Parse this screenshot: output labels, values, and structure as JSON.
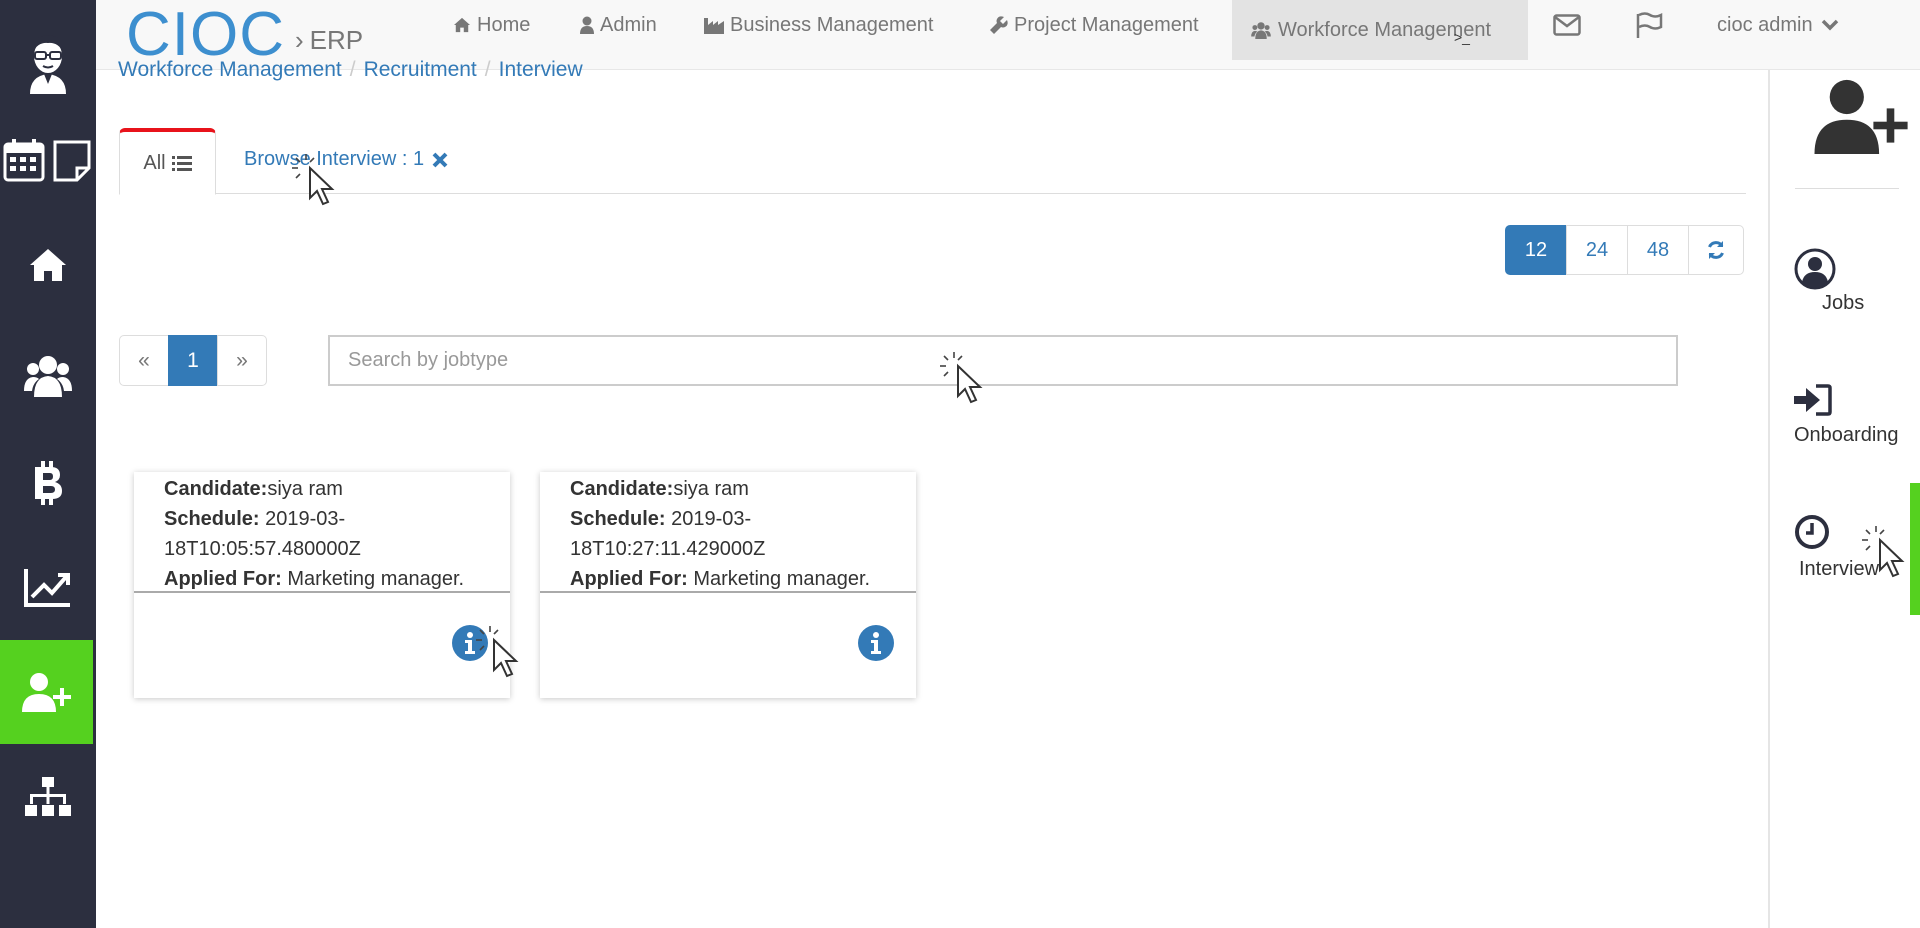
{
  "brand": {
    "logo": "CIOC",
    "separator": "›",
    "subtitle": "ERP"
  },
  "topnav": {
    "items": [
      {
        "label": "Home",
        "icon": "home-icon"
      },
      {
        "label": "Admin",
        "icon": "user-icon"
      },
      {
        "label": "Business Management",
        "icon": "industry-icon"
      },
      {
        "label": "Project Management",
        "icon": "wrench-icon"
      },
      {
        "label": "Workforce Management",
        "icon": "users-icon",
        "active": true
      }
    ],
    "terminal_glyph": ">_",
    "user_label": "cioc admin"
  },
  "sidebar": {
    "items": [
      {
        "name": "avatar",
        "icon": "avatar-icon"
      },
      {
        "name": "calendar-notes",
        "icon": "calendar-icon"
      },
      {
        "name": "home",
        "icon": "home-icon"
      },
      {
        "name": "people",
        "icon": "users-icon"
      },
      {
        "name": "finance",
        "icon": "bitcoin-icon"
      },
      {
        "name": "analytics",
        "icon": "chart-line-icon"
      },
      {
        "name": "workforce",
        "icon": "user-plus-icon",
        "active": true
      },
      {
        "name": "organization",
        "icon": "sitemap-icon"
      }
    ]
  },
  "breadcrumb": [
    "Workforce Management",
    "Recruitment",
    "Interview"
  ],
  "tabs": {
    "all_label": "All",
    "browse_label": "Browse Interview : 1"
  },
  "page_size": {
    "options": [
      "12",
      "24",
      "48"
    ],
    "selected": "12"
  },
  "pagination": {
    "prev": "«",
    "current": "1",
    "next": "»"
  },
  "search": {
    "placeholder": "Search by jobtype",
    "value": ""
  },
  "cards": [
    {
      "candidate_label": "Candidate:",
      "candidate": "siya ram",
      "schedule_label": "Schedule:",
      "schedule_line1": "2019-03-",
      "schedule_line2": "18T10:05:57.480000Z",
      "applied_label": "Applied For:",
      "applied": "Marketing manager."
    },
    {
      "candidate_label": "Candidate:",
      "candidate": "siya ram",
      "schedule_label": "Schedule:",
      "schedule_line1": "2019-03-",
      "schedule_line2": "18T10:27:11.429000Z",
      "applied_label": "Applied For:",
      "applied": "Marketing manager."
    }
  ],
  "right_panel": {
    "items": [
      {
        "label": "Jobs",
        "icon": "user-circle-icon"
      },
      {
        "label": "Onboarding",
        "icon": "sign-in-icon"
      },
      {
        "label": "Interview",
        "icon": "clock-icon",
        "active": true
      }
    ]
  },
  "colors": {
    "sidebar_bg": "#2c2f3f",
    "accent_green": "#55d11f",
    "primary_blue": "#337ab7",
    "tab_red": "#e8131b"
  }
}
